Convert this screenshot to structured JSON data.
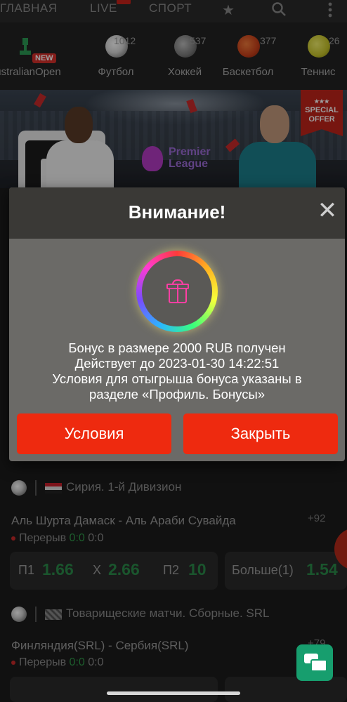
{
  "nav": {
    "tabs": [
      "ГЛАВНАЯ",
      "LIVE",
      "СПОРТ"
    ],
    "icons": [
      "star-icon",
      "search-icon",
      "more-vertical-icon"
    ]
  },
  "sports": [
    {
      "label": "AustralianOpen",
      "count": "",
      "badge": "NEW"
    },
    {
      "label": "Футбол",
      "count": "1012"
    },
    {
      "label": "Хоккей",
      "count": "537"
    },
    {
      "label": "Баскетбол",
      "count": "377"
    },
    {
      "label": "Теннис",
      "count": "26"
    }
  ],
  "banner": {
    "league_line1": "Premier",
    "league_line2": "League",
    "special_line1": "★★★",
    "special_line2": "SPECIAL",
    "special_line3": "OFFER"
  },
  "modal": {
    "title": "Внимание!",
    "close": "✕",
    "line1": "Бонус в размере 2000 RUB получен",
    "line2": "Действует до 2023-01-30 14:22:51",
    "line3": "Условия для отыгрыша бонуса указаны в",
    "line4": "разделе «Профиль. Бонусы»",
    "btn_conditions": "Условия",
    "btn_close": "Закрыть"
  },
  "events": [
    {
      "league": "Сирия. 1-й Дивизион",
      "match": "Аль Шурта Дамаск - Аль Араби Сувайда",
      "status": "Перерыв",
      "score_green": "0:0",
      "score": "0:0",
      "more": "+92",
      "p1_label": "П1",
      "p1": "1.66",
      "x_label": "Х",
      "x": "2.66",
      "p2_label": "П2",
      "p2": "10",
      "total_label": "Больше(1)",
      "total": "1.54"
    },
    {
      "league": "Товарищеские матчи. Сборные. SRL",
      "match": "Финляндия(SRL) - Сербия(SRL)",
      "status": "Перерыв",
      "score_green": "0:0",
      "score": "0:0",
      "more": "+79"
    }
  ]
}
